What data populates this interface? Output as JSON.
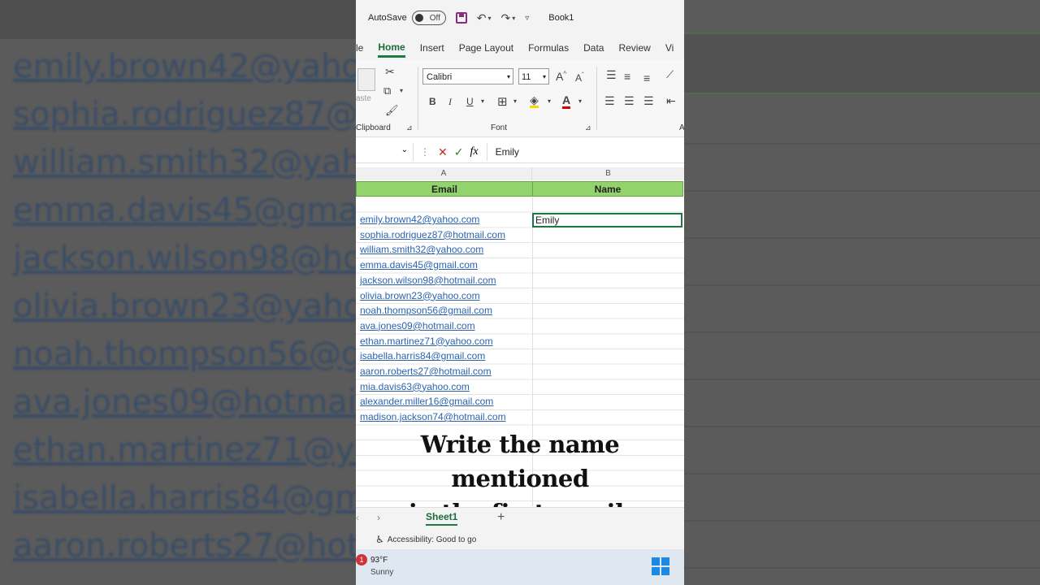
{
  "background": {
    "emails": [
      "emily.brown42@yahoo",
      "sophia.rodriguez87@ho",
      "william.smith32@yaho",
      "emma.davis45@gmail.c",
      "jackson.wilson98@hotr",
      "olivia.brown23@yahoo",
      "noah.thompson56@gm",
      "ava.jones09@hotmail.c",
      "ethan.martinez71@yah",
      "isabella.harris84@gmai",
      "aaron.roberts27@hotm"
    ]
  },
  "titlebar": {
    "autosave_label": "AutoSave",
    "toggle_state": "Off",
    "book_name": "Book1"
  },
  "tabs": [
    "le",
    "Home",
    "Insert",
    "Page Layout",
    "Formulas",
    "Data",
    "Review",
    "Vi"
  ],
  "active_tab": "Home",
  "ribbon": {
    "paste_label": "aste",
    "font_name": "Calibri",
    "font_size": "11",
    "clipboard_label": "Clipboard",
    "font_label": "Font",
    "bold": "B",
    "italic": "I",
    "underline": "U",
    "grow": "A",
    "shrink": "A",
    "alignment_label": "A"
  },
  "formula_bar": {
    "fx": "fx",
    "content": "Emily"
  },
  "columns": {
    "a": "A",
    "b": "B"
  },
  "headers": {
    "email": "Email",
    "name": "Name"
  },
  "emails": [
    "emily.brown42@yahoo.com",
    "sophia.rodriguez87@hotmail.com",
    "william.smith32@yahoo.com",
    "emma.davis45@gmail.com",
    "jackson.wilson98@hotmail.com",
    "olivia.brown23@yahoo.com",
    "noah.thompson56@gmail.com",
    "ava.jones09@hotmail.com",
    "ethan.martinez71@yahoo.com",
    "isabella.harris84@gmail.com",
    "aaron.roberts27@hotmail.com",
    "mia.davis63@yahoo.com",
    "alexander.miller16@gmail.com",
    "madison.jackson74@hotmail.com"
  ],
  "active_cell_value": "Emily",
  "caption": {
    "line1": "Write the name mentioned",
    "line2": "in the first email."
  },
  "sheet": {
    "tab": "Sheet1",
    "add": "+"
  },
  "status": {
    "accessibility": "Accessibility: Good to go"
  },
  "taskbar": {
    "badge": "1",
    "temp": "93°F",
    "weather": "Sunny"
  },
  "colors": {
    "accent": "#217346",
    "header_fill": "#92d36e",
    "link": "#2b63b0"
  }
}
